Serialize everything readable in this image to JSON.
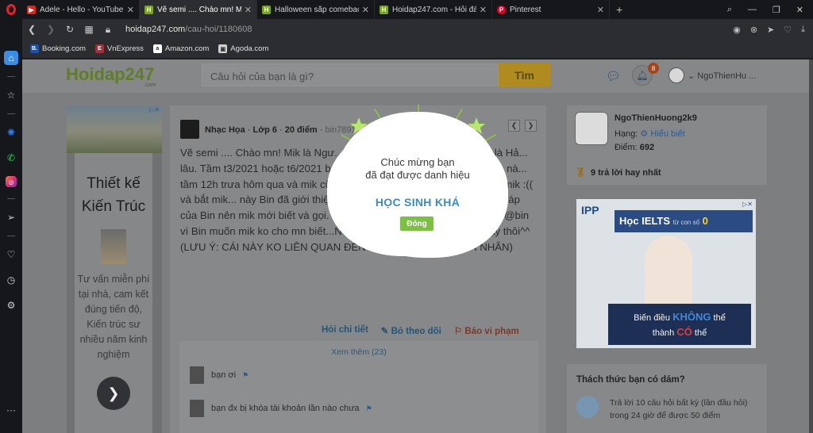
{
  "browser": {
    "tabs": [
      {
        "title": "Adele - Hello - YouTube",
        "color": "#e62117",
        "fav": "▶"
      },
      {
        "title": "Vẽ semi .... Chào mn! Mik là",
        "color": "#7aa520",
        "fav": "H"
      },
      {
        "title": "Halloween sắp comeback r",
        "color": "#7aa520",
        "fav": "H"
      },
      {
        "title": "Hoidap247.com - Hỏi đáp",
        "color": "#7aa520",
        "fav": "H"
      },
      {
        "title": "Pinterest",
        "color": "#e60023",
        "fav": "P"
      }
    ],
    "url_host": "hoidap247.com",
    "url_path": "/cau-hoi/1180608",
    "bookmarks": [
      {
        "label": "Booking.com",
        "fav": "B.",
        "color": "#1b4fa8"
      },
      {
        "label": "VnExpress",
        "fav": "E",
        "color": "#a2313c"
      },
      {
        "label": "Amazon.com",
        "fav": "a",
        "color": "#232f3e"
      },
      {
        "label": "Agoda.com",
        "fav": "▣",
        "color": "#6f6f6f"
      }
    ]
  },
  "site": {
    "logo": "Hoidap247",
    "logo_suffix": ".com",
    "search_placeholder": "Câu hỏi của bạn là gì?",
    "search_button": "Tìm",
    "notification_count": "8",
    "username": "NgoThienHu ..."
  },
  "ad_left": {
    "title": "Thiết kế Kiến Trúc",
    "desc": "Tư vấn miễn phí tại nhà, cam kết đúng tiến độ, Kiến trúc sư nhiều năm kinh nghiệm",
    "arrow": "❯"
  },
  "question": {
    "subject": "Nhạc Họa",
    "grade": "Lớp 6",
    "points": "20 điểm",
    "tag": "bin7891",
    "text": "Vẽ semi .... Chào mn! Mik là Ngư... Mik có chuyện muốn thông báo là Hả... lâu. Tầm t3/2021 hoặc t6/2021 bn... nên Bin cũng đã đưa cho mik acc nà... tầm 12h trưa hôm qua và mik cũng xi... Bin cũng đã biết và nhắc nhở mik :(( và bắt mik... này Bin đã giới thiệu qua về 1 số dân về hay là 1 số... ỏi đáp của Bin nên mik mới biết và gọi. Lúc mik trl câu hỏi họa thì mik có ghi @bin vì Bin muốn mik ko cho mn biết...Nên vậy nhé! Mik chỉ thông báo vậy thôi^^ (LƯU Ý: CÁI NÀY KO LIÊN QUAN ĐẾN CHỨA THÔNG TIN CÁ NHÂN)",
    "actions": {
      "detail": "Hỏi chi tiết",
      "unfollow": "Bỏ theo dõi",
      "report": "Báo vi phạm"
    },
    "see_more": "Xem thêm (23)",
    "comments": [
      {
        "text": "bạn ơi"
      },
      {
        "text": "bạn đx bị khóa tài khoản lần nào chưa"
      }
    ]
  },
  "profile": {
    "name": "NgoThienHuong2k9",
    "rank_label": "Hạng:",
    "rank": "Hiểu biết",
    "points_label": "Điểm:",
    "points": "692",
    "best": "9 trả lời hay nhất"
  },
  "ad_right": {
    "brand": "IPP",
    "headline": "Học IELTS",
    "small": "từ con số",
    "zero": "0",
    "line1": "Biến điều",
    "impossible": "KHÔNG",
    "line1b": "thể",
    "line2": "thành",
    "possible": "CÓ",
    "line2b": "thể"
  },
  "challenge": {
    "title": "Thách thức bạn có dám?",
    "text": "Trả lời 10 câu hỏi bất kỳ (lần đầu hỏi) trong 24 giờ để được 50 điểm"
  },
  "modal": {
    "line1": "Chúc mừng bạn",
    "line2": "đã đạt được danh hiệu",
    "rank": "HỌC SINH KHÁ",
    "button": "Đóng"
  }
}
